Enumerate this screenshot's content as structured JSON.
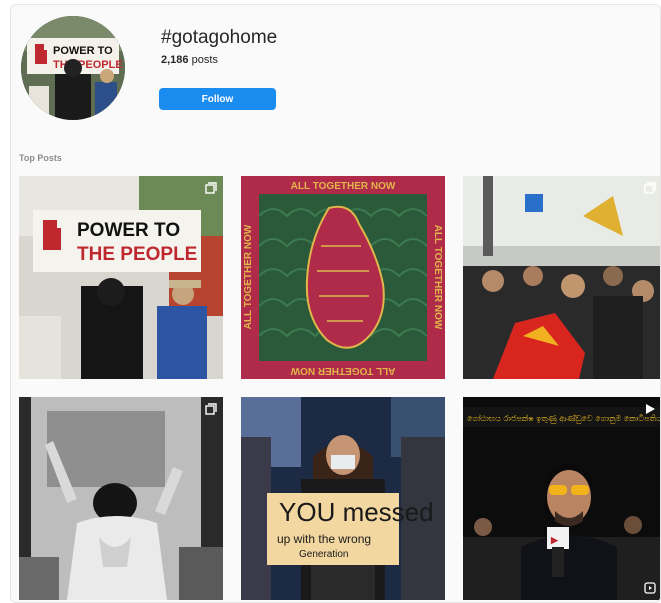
{
  "header": {
    "hashtag": "#gotagohome",
    "post_count": "2,186",
    "post_suffix": " posts",
    "follow_label": "Follow"
  },
  "section": {
    "label": "Top Posts"
  },
  "posts": [
    {
      "sign_line1": "POWER TO",
      "sign_line2": "THE PEOPLE",
      "icon": "multiple-photos-icon"
    },
    {
      "border_text": "ALL TOGETHER NOW",
      "icon": "none"
    },
    {
      "icon": "multiple-photos-icon"
    },
    {
      "icon": "multiple-photos-icon"
    },
    {
      "sign_line1": "YOU messed",
      "sign_line2": "up with the wrong",
      "sign_line3": "Generation",
      "icon": "none"
    },
    {
      "caption": "ගෝඨාභය රාජපක්ෂ ඉතුණු ආණ්ඩුවෙ ගොනුම කොටිපතිය උගේ කෙ",
      "icon": "video-play-icon"
    }
  ],
  "colors": {
    "follow_bg": "#1a8cf0",
    "poster_red": "#b02a4a",
    "poster_green": "#2a5a3a"
  }
}
